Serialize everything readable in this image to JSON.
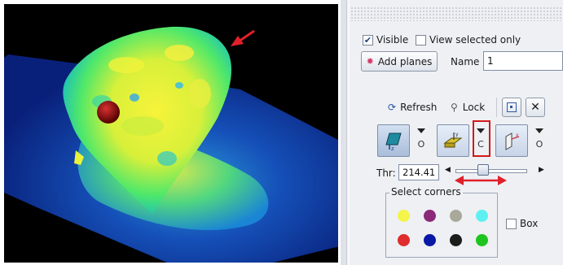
{
  "viewer": {
    "annotation_color": "#e0202a"
  },
  "panel": {
    "visible_label": "Visible",
    "visible_checked": true,
    "view_selected_label": "View selected only",
    "view_selected_checked": false,
    "add_planes_label": "Add planes",
    "name_label": "Name",
    "name_value": "1",
    "refresh_label": "Refresh",
    "lock_label": "Lock",
    "plane_axial_mode": "O",
    "plane_coronal_mode": "C",
    "plane_sagittal_mode": "O",
    "threshold_label": "Thr:",
    "threshold_value": "214.41",
    "threshold_slider": 0.36,
    "select_corners_label": "Select corners",
    "box_label": "Box",
    "box_checked": false,
    "corner_colors": [
      "#f4f44a",
      "#8a2a78",
      "#a8a99a",
      "#5ef0f0",
      "#e02c2c",
      "#0a18a6",
      "#1c1c1c",
      "#1ec41e"
    ]
  }
}
